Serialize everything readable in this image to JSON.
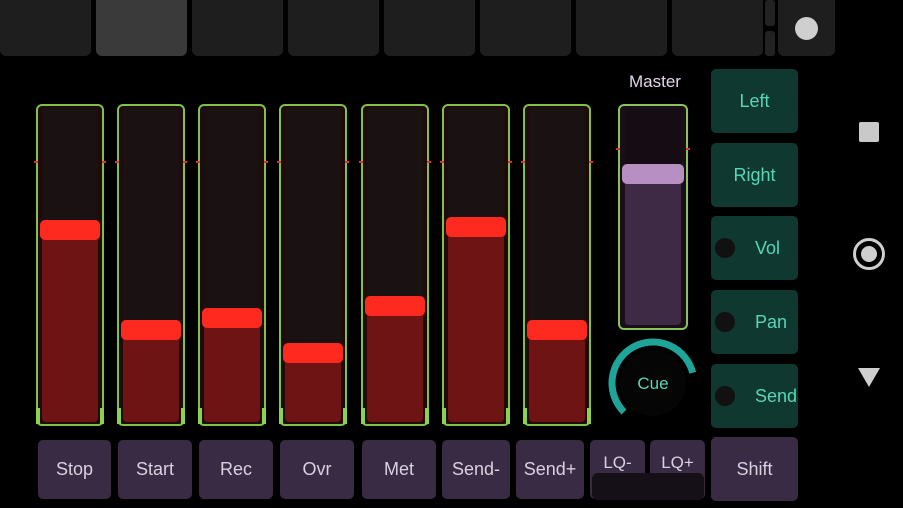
{
  "top_tabs": {
    "count": 8,
    "active_index": 1
  },
  "faders": [
    {
      "level": 0.62
    },
    {
      "level": 0.28
    },
    {
      "level": 0.32
    },
    {
      "level": 0.2
    },
    {
      "level": 0.36
    },
    {
      "level": 0.63
    },
    {
      "level": 0.28
    }
  ],
  "master": {
    "label": "Master",
    "level": 0.72
  },
  "bottom_buttons": {
    "stop": "Stop",
    "start": "Start",
    "rec": "Rec",
    "ovr": "Ovr",
    "met": "Met",
    "send_minus": "Send-",
    "send_plus": "Send+",
    "lq_minus": "LQ-",
    "lq_plus": "LQ+",
    "shift": "Shift"
  },
  "side_buttons": {
    "left": "Left",
    "right": "Right",
    "vol": "Vol",
    "pan": "Pan",
    "send": "Send"
  },
  "cue_knob": {
    "label": "Cue",
    "value": 0.78
  },
  "colors": {
    "fader_outline": "#7fc24a",
    "fader_cap": "#ff2a1f",
    "fader_fill": "#6e1414",
    "teal_text": "#58d6b6",
    "teal_button": "#0f3830",
    "purple_button": "#3a2b45",
    "master_cap": "#b88fc2"
  },
  "icons": [
    "record-circle-icon",
    "nav-recents-square-icon",
    "nav-home-circle-icon",
    "nav-back-triangle-icon"
  ]
}
